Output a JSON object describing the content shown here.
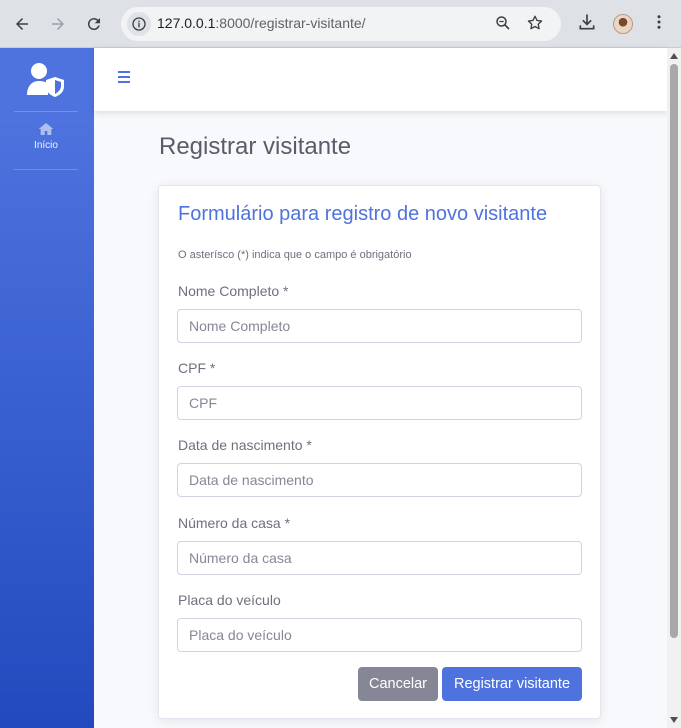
{
  "browser": {
    "url_host": "127.0.0.1",
    "url_rest": ":8000/registrar-visitante/",
    "icons": [
      "back-icon",
      "forward-icon",
      "reload-icon",
      "site-info-icon",
      "zoom-icon",
      "star-icon",
      "download-icon",
      "profile-avatar",
      "menu-dots-icon"
    ]
  },
  "sidebar": {
    "brand_icon": "user-shield-icon",
    "items": [
      {
        "label": "Início",
        "icon": "home-icon",
        "active": true
      }
    ]
  },
  "topbar": {
    "toggle_icon": "hamburger-icon"
  },
  "page": {
    "title": "Registrar visitante"
  },
  "form": {
    "heading": "Formulário para registro de novo visitante",
    "hint": "O asterísco (*) indica que o campo é obrigatório",
    "fields": [
      {
        "label": "Nome Completo *",
        "placeholder": "Nome Completo",
        "value": ""
      },
      {
        "label": "CPF *",
        "placeholder": "CPF",
        "value": ""
      },
      {
        "label": "Data de nascimento *",
        "placeholder": "Data de nascimento",
        "value": ""
      },
      {
        "label": "Número da casa *",
        "placeholder": "Número da casa",
        "value": ""
      },
      {
        "label": "Placa do veículo",
        "placeholder": "Placa do veículo",
        "value": ""
      }
    ],
    "cancel_label": "Cancelar",
    "submit_label": "Registrar visitante"
  },
  "colors": {
    "primary": "#4e73df",
    "secondary": "#858796",
    "sidebar_gradient_end": "#224abe"
  }
}
